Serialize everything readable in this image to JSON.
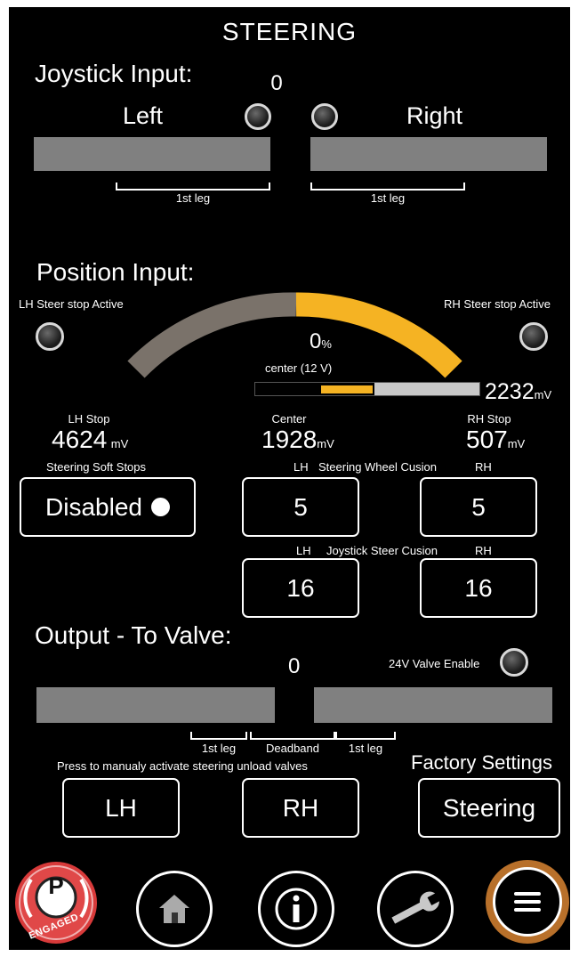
{
  "screen_title": "STEERING",
  "joystick": {
    "heading": "Joystick Input:",
    "value": "0",
    "left_label": "Left",
    "right_label": "Right",
    "left_leg_label": "1st leg",
    "right_leg_label": "1st leg",
    "left_level": 0,
    "right_level": 0
  },
  "position": {
    "heading": "Position Input:",
    "lh_stop_active_label": "LH Steer stop Active",
    "rh_stop_active_label": "RH Steer stop Active",
    "percent_value": "0",
    "percent_unit": "%",
    "center_label": "center (12 V)",
    "voltage_value": "2232",
    "voltage_unit": "mV",
    "arc_colors": {
      "left": "#7a726a",
      "right": "#f5b323"
    },
    "lh_stop": {
      "label": "LH Stop",
      "value": "4624",
      "unit": "mV"
    },
    "center": {
      "label": "Center",
      "value": "1928",
      "unit": "mV"
    },
    "rh_stop": {
      "label": "RH Stop",
      "value": "507",
      "unit": "mV"
    }
  },
  "soft_stops": {
    "label": "Steering Soft Stops",
    "value": "Disabled"
  },
  "wheel_cushion": {
    "lh_label": "LH",
    "label": "Steering Wheel Cusion",
    "rh_label": "RH",
    "lh_value": "5",
    "rh_value": "5"
  },
  "joystick_cushion": {
    "lh_label": "LH",
    "label": "Joystick Steer Cusion",
    "rh_label": "RH",
    "lh_value": "16",
    "rh_value": "16"
  },
  "output": {
    "heading": "Output - To Valve:",
    "value": "0",
    "valve_enable_label": "24V Valve Enable",
    "left_leg_label": "1st leg",
    "deadband_label": "Deadband",
    "right_leg_label": "1st leg"
  },
  "unload": {
    "label": "Press to manualy activate steering unload valves",
    "lh_button": "LH",
    "rh_button": "RH"
  },
  "factory": {
    "label": "Factory Settings",
    "button": "Steering"
  },
  "nav": {
    "parking_letter": "P",
    "parking_status": "ENGAGED",
    "items": [
      "parking-brake",
      "home",
      "info",
      "settings-wrench",
      "menu"
    ]
  },
  "colors": {
    "accent": "#f5b323",
    "bar": "#808080",
    "menu_ring": "#b8702a"
  }
}
